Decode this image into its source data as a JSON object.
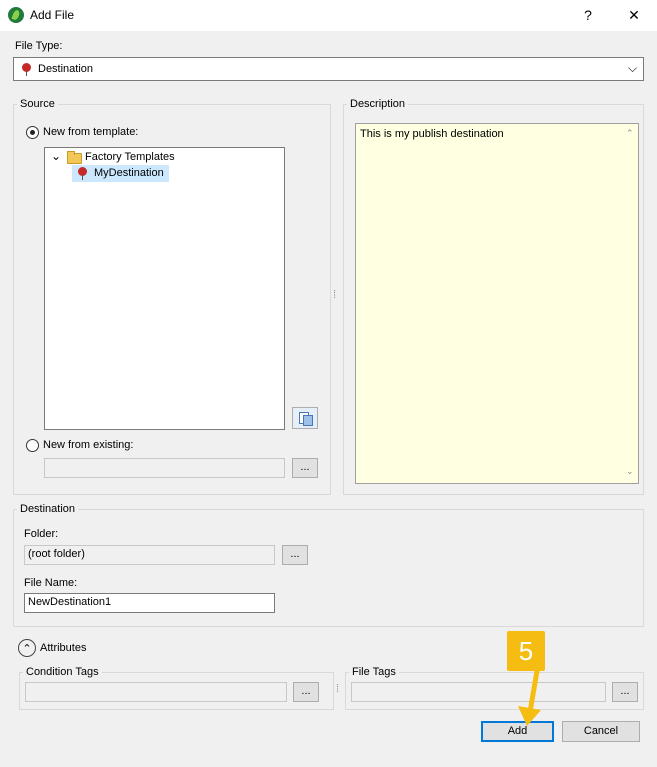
{
  "window": {
    "title": "Add File",
    "help_glyph": "?",
    "close_glyph": "✕"
  },
  "file_type": {
    "label": "File Type:",
    "value": "Destination",
    "icon": "location-pin-icon",
    "chevron": "⌵"
  },
  "source": {
    "group_label": "Source",
    "new_from_template_label": "New from template:",
    "new_from_template_selected": true,
    "tree": {
      "folder_label": "Factory Templates",
      "item_label": "MyDestination",
      "expand_glyph": "⌄"
    },
    "new_from_existing_label": "New from existing:",
    "new_from_existing_value": "",
    "browse_label": "..."
  },
  "description": {
    "group_label": "Description",
    "text": "This is my publish destination",
    "scroll_up": "⌃",
    "scroll_down": "⌄",
    "splitter_glyph": "⁞"
  },
  "destination": {
    "group_label": "Destination",
    "folder_label": "Folder:",
    "folder_value": "(root folder)",
    "browse_label": "...",
    "file_name_label": "File Name:",
    "file_name_value": "NewDestination1"
  },
  "attributes": {
    "toggle_label": "Attributes",
    "toggle_glyph": "⌃",
    "condition_tags_label": "Condition Tags",
    "condition_tags_value": "",
    "file_tags_label": "File Tags",
    "file_tags_value": "",
    "browse_label": "...",
    "splitter_glyph": "⁞"
  },
  "buttons": {
    "add": "Add",
    "cancel": "Cancel"
  },
  "callout": {
    "step": "5",
    "color": "#f5bd12"
  },
  "colors": {
    "description_bg": "#ffffe1",
    "selection_bg": "#cce8ff",
    "focus_border": "#0078d7"
  }
}
